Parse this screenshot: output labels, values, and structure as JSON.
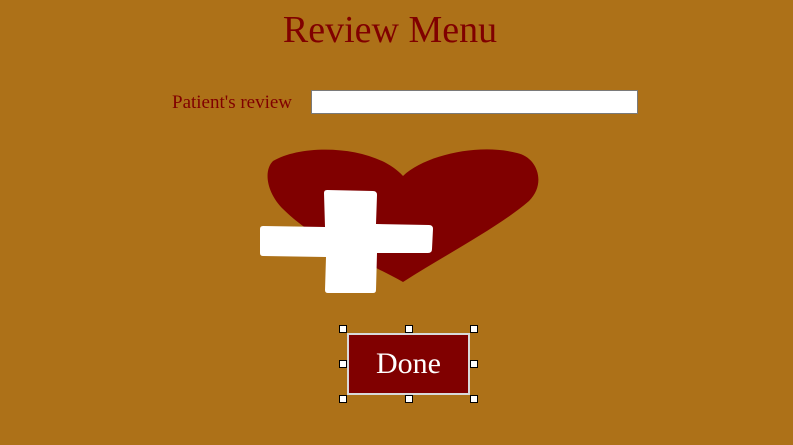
{
  "page": {
    "title": "Review Menu"
  },
  "form": {
    "review_label": "Patient's review",
    "review_value": ""
  },
  "logo": {
    "icon": "heart-with-plus-icon"
  },
  "actions": {
    "done_label": "Done"
  },
  "colors": {
    "background": "#AD7118",
    "accent": "#800000",
    "input_background": "#FFFFFF",
    "button_text": "#FFFFFF"
  }
}
